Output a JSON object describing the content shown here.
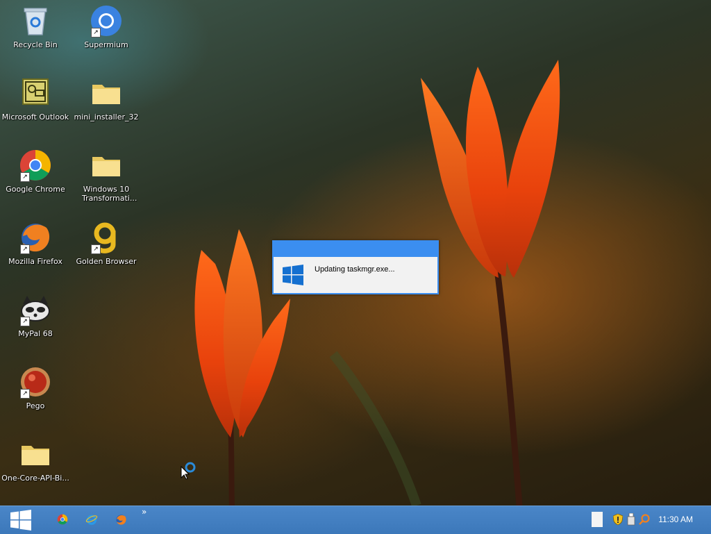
{
  "desktop": {
    "icons": [
      {
        "label": "Recycle Bin",
        "icon": "recycle-bin-icon"
      },
      {
        "label": "Supermium",
        "icon": "supermium-icon"
      },
      {
        "label": "Microsoft Outlook",
        "icon": "outlook-icon"
      },
      {
        "label": "mini_installer_32",
        "icon": "folder-icon"
      },
      {
        "label": "Google Chrome",
        "icon": "chrome-icon"
      },
      {
        "label": "Windows 10 Transformati...",
        "icon": "folder-icon"
      },
      {
        "label": "Mozilla Firefox",
        "icon": "firefox-icon"
      },
      {
        "label": "Golden Browser",
        "icon": "golden-browser-icon"
      },
      {
        "label": "MyPal 68",
        "icon": "mypal-icon"
      },
      {
        "label": "Pego",
        "icon": "pego-icon"
      },
      {
        "label": "One-Core-API-Bi...",
        "icon": "folder-icon"
      }
    ]
  },
  "dialog": {
    "message": "Updating taskmgr.exe..."
  },
  "taskbar": {
    "pinned": [
      "chrome-icon",
      "internet-explorer-icon",
      "firefox-icon"
    ],
    "overflow": "»",
    "tray": [
      "shield-icon",
      "usb-icon",
      "search-icon"
    ],
    "clock": "11:30 AM"
  },
  "colors": {
    "taskbar": "#3c78ba",
    "dialog_title": "#3b8ef0",
    "windows_logo": "#1570d0"
  }
}
